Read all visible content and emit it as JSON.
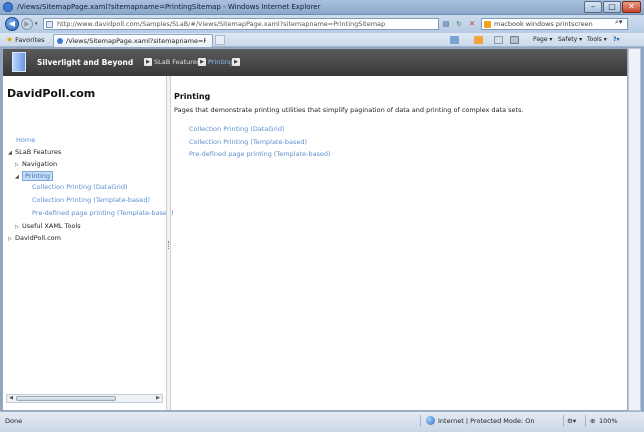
{
  "window": {
    "title": "/Views/SitemapPage.xaml?sitemapname=PrintingSitemap - Windows Internet Explorer",
    "minimize": "–",
    "maximize": "□",
    "close": "✕"
  },
  "navbar": {
    "back": "◀",
    "forward": "▶",
    "dropdown": "▾",
    "address": "http://www.davidpoll.com/Samples/SLaB/#/Views/SitemapPage.xaml?sitemapname=PrintingSitemap",
    "search_query": "macbook windows printscreen"
  },
  "favorites": {
    "label": "Favorites",
    "tab_label": "/Views/SitemapPage.xaml?sitemapname=Printin..."
  },
  "commands": {
    "page": "Page ▾",
    "safety": "Safety ▾",
    "tools": "Tools ▾",
    "help": "?▾"
  },
  "site": {
    "app_title": "Silverlight and Beyond",
    "breadcrumb": [
      "SLaB Features",
      "Printing"
    ],
    "name": "DavidPoll.com"
  },
  "tree": [
    {
      "label": "Home",
      "arrow": "",
      "link": true
    },
    {
      "label": "SLaB Features",
      "arrow": "◢",
      "link": false
    },
    {
      "label": "Navigation",
      "arrow": "▷",
      "link": false
    },
    {
      "label": "Printing",
      "arrow": "◢",
      "link": true,
      "selected": true
    },
    {
      "label": "Collection Printing (DataGrid)",
      "arrow": "",
      "link": true
    },
    {
      "label": "Collection Printing (Template-based)",
      "arrow": "",
      "link": true
    },
    {
      "label": "Pre-defined page printing (Template-based)",
      "arrow": "",
      "link": true
    },
    {
      "label": "Useful XAML Tools",
      "arrow": "▷",
      "link": false
    },
    {
      "label": "DavidPoll.com",
      "arrow": "▷",
      "link": false
    }
  ],
  "content": {
    "title": "Printing",
    "description": "Pages that demonstrate printing utilities that simplify pagination of data and printing of complex data sets.",
    "links": [
      "Collection Printing (DataGrid)",
      "Collection Printing (Template-based)",
      "Pre-defined page printing (Template-based)"
    ]
  },
  "status": {
    "left": "Done",
    "zone": "Internet | Protected Mode: On",
    "zoom": "100%"
  }
}
